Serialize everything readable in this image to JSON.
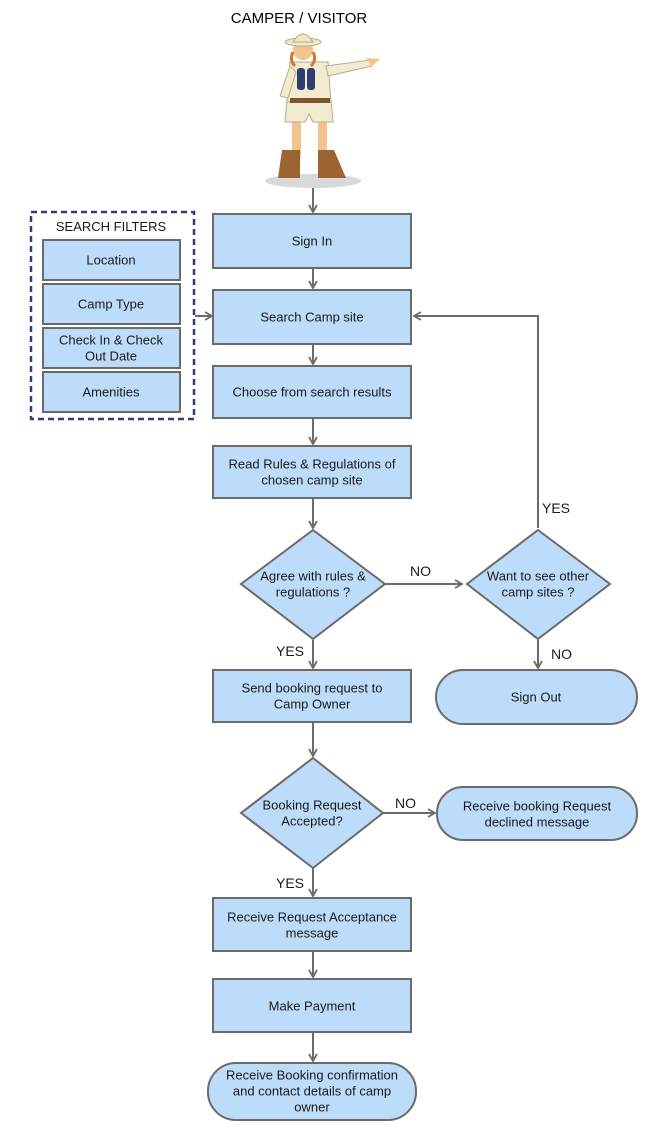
{
  "title": "CAMPER / VISITOR",
  "actor_icon": "camper-illustration",
  "colors": {
    "node_fill": "#bcdcfa",
    "node_stroke": "#6b6b6b",
    "filter_border": "#2b3f7a",
    "text": "#1a1a1a"
  },
  "search_filters": {
    "heading": "SEARCH FILTERS",
    "items": [
      "Location",
      "Camp Type",
      "Check In & Check|Out Date",
      "Amenities"
    ]
  },
  "nodes": {
    "sign_in": "Sign In",
    "search": "Search Camp site",
    "choose": "Choose from search results",
    "read_rules": "Read Rules & Regulations of|chosen camp site",
    "agree": "Agree with rules &|regulations ?",
    "other_sites": "Want to see other|camp sites ?",
    "sign_out": "Sign Out",
    "send_request": "Send booking request to|Camp Owner",
    "accepted": "Booking Request|Accepted?",
    "declined": "Receive booking Request|declined message",
    "acceptance": "Receive Request Acceptance|message",
    "payment": "Make Payment",
    "confirmation": "Receive Booking confirmation|and contact details of camp|owner"
  },
  "edge_labels": {
    "agree_no": "NO",
    "agree_yes": "YES",
    "other_yes": "YES",
    "other_no": "NO",
    "accepted_no": "NO",
    "accepted_yes": "YES"
  }
}
